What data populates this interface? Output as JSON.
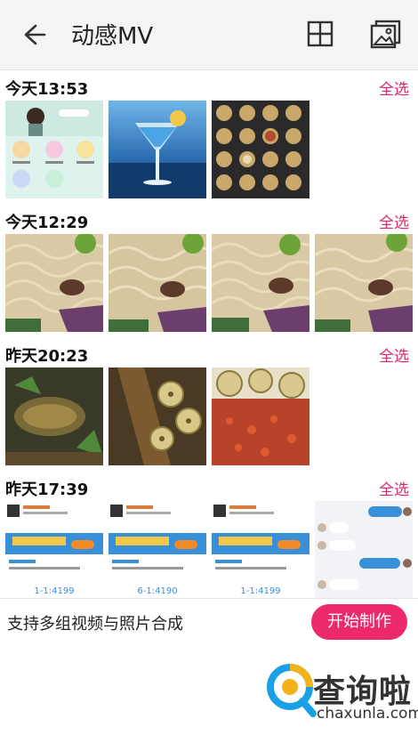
{
  "header": {
    "title": "动感MV",
    "icons": [
      "back-arrow-icon",
      "grid-icon",
      "album-icon"
    ]
  },
  "sections": [
    {
      "time": "今天13:53",
      "select_all": "全选",
      "thumbs": [
        {
          "kind": "app-screenshot"
        },
        {
          "kind": "cocktail"
        },
        {
          "kind": "food-grid"
        }
      ]
    },
    {
      "time": "今天12:29",
      "select_all": "全选",
      "thumbs": [
        {
          "kind": "noodles"
        },
        {
          "kind": "noodles"
        },
        {
          "kind": "noodles"
        },
        {
          "kind": "noodles"
        }
      ]
    },
    {
      "time": "昨天20:23",
      "select_all": "全选",
      "thumbs": [
        {
          "kind": "fish"
        },
        {
          "kind": "lotus-skewer"
        },
        {
          "kind": "chili-lotus"
        }
      ]
    },
    {
      "time": "昨天17:39",
      "select_all": "全选",
      "thumbs": [
        {
          "kind": "game-screenshot",
          "price": "1-1:4199"
        },
        {
          "kind": "game-screenshot",
          "price": "6-1:4190"
        },
        {
          "kind": "game-screenshot",
          "price": "1-1:4199"
        },
        {
          "kind": "chat-screenshot"
        }
      ]
    }
  ],
  "bottom": {
    "hint": "支持多组视频与照片合成",
    "start_button": "开始制作"
  },
  "watermark": {
    "cn": "查询啦",
    "en": "chaxunla.com"
  },
  "colors": {
    "accent": "#e0266c",
    "button": "#ec2a6b",
    "header_bg": "#f4f4f4"
  }
}
